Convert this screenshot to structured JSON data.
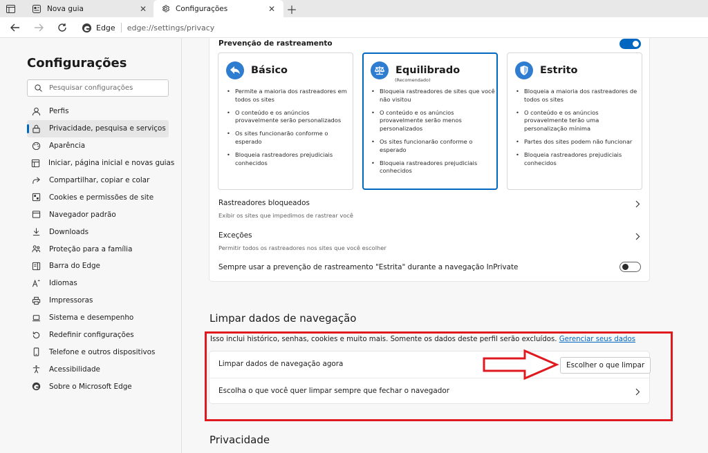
{
  "tabs": [
    {
      "label": "Nova guia",
      "icon": "newtab-icon",
      "active": false
    },
    {
      "label": "Configurações",
      "icon": "gear-icon",
      "active": true
    }
  ],
  "address": {
    "site": "Edge",
    "url": "edge://settings/privacy"
  },
  "sidebar": {
    "title": "Configurações",
    "search_placeholder": "Pesquisar configurações",
    "items": [
      {
        "label": "Perfis",
        "icon": "profile-icon"
      },
      {
        "label": "Privacidade, pesquisa e serviços",
        "icon": "lock-icon",
        "selected": true
      },
      {
        "label": "Aparência",
        "icon": "appearance-icon"
      },
      {
        "label": "Iniciar, página inicial e novas guias",
        "icon": "home-icon"
      },
      {
        "label": "Compartilhar, copiar e colar",
        "icon": "share-icon"
      },
      {
        "label": "Cookies e permissões de site",
        "icon": "cookie-icon"
      },
      {
        "label": "Navegador padrão",
        "icon": "browser-icon"
      },
      {
        "label": "Downloads",
        "icon": "download-icon"
      },
      {
        "label": "Proteção para a família",
        "icon": "family-icon"
      },
      {
        "label": "Barra do Edge",
        "icon": "edge-bar-icon"
      },
      {
        "label": "Idiomas",
        "icon": "language-icon"
      },
      {
        "label": "Impressoras",
        "icon": "printer-icon"
      },
      {
        "label": "Sistema e desempenho",
        "icon": "laptop-icon"
      },
      {
        "label": "Redefinir configurações",
        "icon": "reset-icon"
      },
      {
        "label": "Telefone e outros dispositivos",
        "icon": "phone-icon"
      },
      {
        "label": "Acessibilidade",
        "icon": "accessibility-icon"
      },
      {
        "label": "Sobre o Microsoft Edge",
        "icon": "edge-logo-icon"
      }
    ]
  },
  "tracking": {
    "title": "Prevenção de rastreamento",
    "enabled": true,
    "levels": [
      {
        "name": "Básico",
        "subtitle": "",
        "icon": "basic-icon",
        "selected": false,
        "bullets": [
          "Permite a maioria dos rastreadores em todos os sites",
          "O conteúdo e os anúncios provavelmente serão personalizados",
          "Os sites funcionarão conforme o esperado",
          "Bloqueia rastreadores prejudiciais conhecidos"
        ]
      },
      {
        "name": "Equilibrado",
        "subtitle": "(Recomendado)",
        "icon": "balance-icon",
        "selected": true,
        "bullets": [
          "Bloqueia rastreadores de sites que você não visitou",
          "O conteúdo e os anúncios provavelmente serão menos personalizados",
          "Os sites funcionarão conforme o esperado",
          "Bloqueia rastreadores prejudiciais conhecidos"
        ]
      },
      {
        "name": "Estrito",
        "subtitle": "",
        "icon": "shield-icon",
        "selected": false,
        "bullets": [
          "Bloqueia a maioria dos rastreadores de todos os sites",
          "O conteúdo e os anúncios provavelmente terão uma personalização mínima",
          "Partes dos sites podem não funcionar",
          "Bloqueia rastreadores prejudiciais conhecidos"
        ]
      }
    ],
    "blocked": {
      "title": "Rastreadores bloqueados",
      "subtitle": "Exibir os sites que impedimos de rastrear você"
    },
    "exceptions": {
      "title": "Exceções",
      "subtitle": "Permitir todos os rastreadores nos sites que você escolher"
    },
    "inprivate": {
      "title": "Sempre usar a prevenção de rastreamento \"Estrita\" durante a navegação InPrivate",
      "enabled": false
    }
  },
  "clear": {
    "section_title": "Limpar dados de navegação",
    "description": "Isso inclui histórico, senhas, cookies e muito mais. Somente os dados deste perfil serão excluídos.",
    "manage_link": "Gerenciar seus dados",
    "now_label": "Limpar dados de navegação agora",
    "choose_button": "Escolher o que limpar",
    "on_close_label": "Escolha o que você quer limpar sempre que fechar o navegador"
  },
  "privacy": {
    "section_title": "Privacidade"
  },
  "colors": {
    "accent": "#0067c0",
    "highlight": "#e0191f"
  }
}
